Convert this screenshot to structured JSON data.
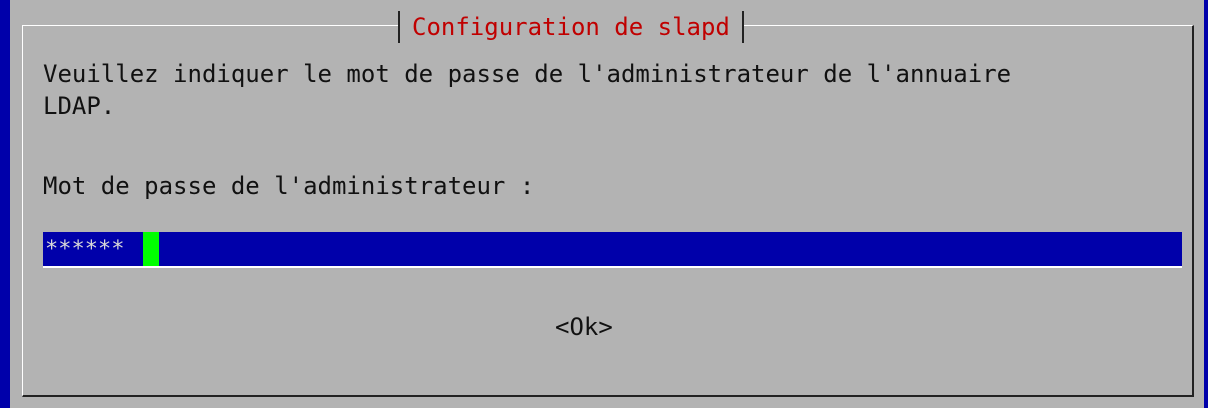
{
  "dialog": {
    "title": "Configuration de slapd",
    "message_line1": "Veuillez indiquer le mot de passe de l'administrateur de l'annuaire",
    "message_line2": "LDAP.",
    "prompt_label": "Mot de passe de l'administrateur :",
    "password_masked_value": "******",
    "ok_button_label": "<Ok>"
  },
  "colors": {
    "background": "#b3b3b3",
    "title_text": "#c00000",
    "field_background": "#0000aa",
    "cursor": "#00ff00",
    "terminal_edge": "#0000aa"
  }
}
